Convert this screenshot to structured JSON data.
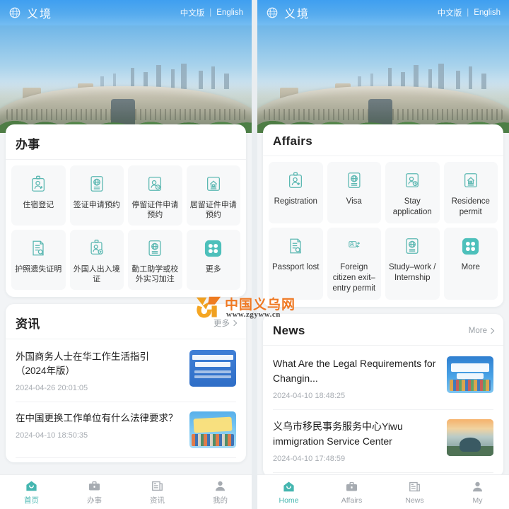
{
  "colors": {
    "accent": "#45b6b0",
    "header_blue": "#56abee",
    "tile_bg": "#f7f8f9",
    "muted_text": "#9aa0a6",
    "watermark_orange": "#ef7822"
  },
  "panels": [
    {
      "lang": "zh",
      "header": {
        "logo_icon": "globe-emblem-icon",
        "title": "义境",
        "lang_chinese": "中文版",
        "lang_separator": "|",
        "lang_english": "English"
      },
      "hero": {
        "alt": "yiwu-international-trade-city-aerial-photo"
      },
      "affairs": {
        "title": "办事",
        "tiles": [
          {
            "icon": "id-badge-person-icon",
            "label": "住宿登记"
          },
          {
            "icon": "passport-globe-icon",
            "label": "签证申请预约"
          },
          {
            "icon": "id-card-clock-icon",
            "label": "停留证件申请预约"
          },
          {
            "icon": "home-certificate-icon",
            "label": "居留证件申请预约"
          },
          {
            "icon": "document-search-icon",
            "label": "护照遗失证明"
          },
          {
            "icon": "id-card-plus-icon",
            "label": "外国人出入境证"
          },
          {
            "icon": "passport-globe-icon",
            "label": "勤工助学或校外实习加注"
          },
          {
            "icon": "grid-more-icon",
            "label": "更多"
          }
        ]
      },
      "news": {
        "title": "资讯",
        "more_label": "更多",
        "more_icon": "chevron-right-icon",
        "items": [
          {
            "title": "外国商务人士在华工作生活指引 （2024年版）",
            "time": "2024-04-26 20:01:05",
            "thumb": "book-cover-blue"
          },
          {
            "title": "在中国更换工作单位有什么法律要求？",
            "time": "2024-04-10 18:50:35",
            "thumb": "legal-illustration-cyan"
          }
        ]
      },
      "tabbar": [
        {
          "icon": "home-icon",
          "label": "首页",
          "active": true
        },
        {
          "icon": "briefcase-icon",
          "label": "办事",
          "active": false
        },
        {
          "icon": "newspaper-icon",
          "label": "资讯",
          "active": false
        },
        {
          "icon": "person-icon",
          "label": "我的",
          "active": false
        }
      ]
    },
    {
      "lang": "en",
      "header": {
        "logo_icon": "globe-emblem-icon",
        "title": "义境",
        "lang_chinese": "中文版",
        "lang_separator": "|",
        "lang_english": "English"
      },
      "hero": {
        "alt": "yiwu-international-trade-city-aerial-photo"
      },
      "affairs": {
        "title": "Affairs",
        "tiles": [
          {
            "icon": "id-badge-person-icon",
            "label": "Registration"
          },
          {
            "icon": "passport-globe-icon",
            "label": "Visa"
          },
          {
            "icon": "id-card-clock-icon",
            "label": "Stay application"
          },
          {
            "icon": "home-certificate-icon",
            "label": "Residence permit"
          },
          {
            "icon": "document-search-icon",
            "label": "Passport lost"
          },
          {
            "icon": "exit-entry-permit-icon",
            "label": "Foreign citizen exit–entry permit"
          },
          {
            "icon": "passport-globe-icon",
            "label": "Study–work / Internship"
          },
          {
            "icon": "grid-more-icon",
            "label": "More"
          }
        ]
      },
      "news": {
        "title": "News",
        "more_label": "More",
        "more_icon": "chevron-right-icon",
        "items": [
          {
            "title": "What Are the Legal Requirements for Changin...",
            "time": "2024-04-10 18:48:25",
            "thumb": "legal-tips-illustration"
          },
          {
            "title": "义乌市移民事务服务中心Yiwu immigration Service Center",
            "time": "2024-04-10 17:48:59",
            "thumb": "city-sunset-photo"
          }
        ]
      },
      "tabbar": [
        {
          "icon": "home-icon",
          "label": "Home",
          "active": true
        },
        {
          "icon": "briefcase-icon",
          "label": "Affairs",
          "active": false
        },
        {
          "icon": "newspaper-icon",
          "label": "News",
          "active": false
        },
        {
          "icon": "person-icon",
          "label": "My",
          "active": false
        }
      ]
    }
  ],
  "watermark": {
    "logo_icon": "zgyww-bird-logo-icon",
    "text": "中国义乌网",
    "url": "www.zgyww.cn"
  }
}
